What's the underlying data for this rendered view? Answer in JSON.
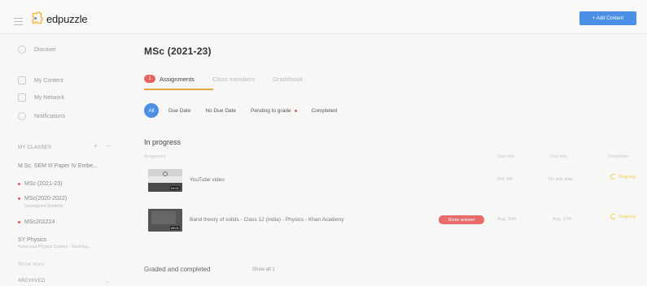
{
  "header": {
    "logo_text": "edpuzzle",
    "add_content_label": "+ Add Content"
  },
  "sidebar": {
    "nav": [
      {
        "label": "Discover",
        "icon": "compass-icon"
      },
      {
        "label": "My Content",
        "icon": "folder-icon"
      },
      {
        "label": "My Network",
        "icon": "network-icon"
      },
      {
        "label": "Notifications",
        "icon": "bell-icon"
      }
    ],
    "classes_label": "MY CLASSES",
    "classes": [
      {
        "label": "M.Sc. SEM III Paper IV Embe..."
      },
      {
        "label": "MSc (2021-23)",
        "dot": true
      },
      {
        "label": "MSc(2020-2022)",
        "dot": true,
        "sub": "Unassigned Students"
      },
      {
        "label": "MSc202224",
        "dot": true
      },
      {
        "label": "SY Physics",
        "sub": "Know your Physics Content - Teaching..."
      }
    ],
    "show_more": "Show more",
    "archived_label": "ARCHIVED"
  },
  "main": {
    "title": "MSc (2021-23)",
    "more": "···",
    "tabs": [
      {
        "label": "Assignments",
        "badge": "1",
        "active": true
      },
      {
        "label": "Class members"
      },
      {
        "label": "Gradebook"
      }
    ],
    "filters": [
      "All",
      "Due Date",
      "No Due Date",
      "Pending to grade",
      "Completed"
    ],
    "in_progress_label": "In progress",
    "columns": {
      "assignment": "Assignment",
      "start_date": "Start date",
      "due_date": "Due date",
      "completion": "Completion"
    },
    "assignments": [
      {
        "title": "YouTube video",
        "duration": "04:01",
        "start": "Oct. 5th",
        "due": "No due date",
        "status": "Ongoing"
      },
      {
        "title": "Band theory of solids - Class 12 (India) - Physics - Khan Academy",
        "duration": "08:01",
        "button": "Show answer",
        "start": "Aug. 10th",
        "due": "Aug. 27th",
        "status": "Ongoing"
      }
    ],
    "graded_label": "Graded and completed",
    "show_all": "Show all 1"
  }
}
